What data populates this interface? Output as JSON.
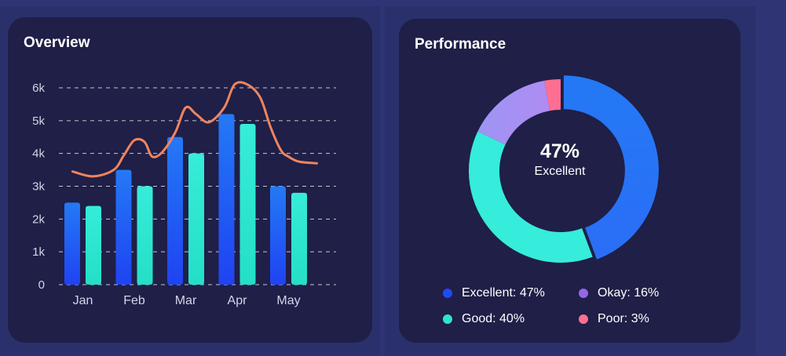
{
  "overview": {
    "title": "Overview",
    "chart_data": {
      "type": "bar",
      "categories": [
        "Jan",
        "Feb",
        "Mar",
        "Apr",
        "May"
      ],
      "series": [
        {
          "values": [
            2500,
            3500,
            4500,
            5200,
            3000
          ],
          "color": "#2160f0"
        },
        {
          "values": [
            2400,
            3000,
            4000,
            4900,
            2800
          ],
          "color": "#2ee8d2"
        }
      ],
      "line_series": {
        "color": "#f0845e",
        "x": [
          -0.2,
          0.2,
          0.6,
          0.8,
          1.0,
          1.2,
          1.35,
          1.55,
          1.8,
          2.0,
          2.2,
          2.45,
          2.75,
          2.95,
          3.2,
          3.45,
          3.65,
          3.85,
          4.0,
          4.2,
          4.55
        ],
        "values": [
          3450,
          3300,
          3500,
          3950,
          4400,
          4350,
          3900,
          4050,
          4650,
          5400,
          5200,
          4950,
          5400,
          6100,
          6100,
          5700,
          4800,
          4100,
          3900,
          3750,
          3700
        ]
      },
      "y_ticks": [
        0,
        1000,
        2000,
        3000,
        4000,
        5000,
        6000
      ],
      "y_tick_labels": [
        "0",
        "1k",
        "2k",
        "3k",
        "4k",
        "5k",
        "6k"
      ],
      "ylim": [
        0,
        6000
      ],
      "grid": true,
      "title": "Overview",
      "xlabel": "",
      "ylabel": ""
    }
  },
  "performance": {
    "title": "Performance",
    "center_value": "47%",
    "center_label": "Excellent",
    "chart_data": {
      "type": "pie",
      "title": "Performance",
      "slices": [
        {
          "label": "Excellent",
          "value": 47,
          "color": "#2479f5"
        },
        {
          "label": "Good",
          "value": 40,
          "color": "#36ecda"
        },
        {
          "label": "Okay",
          "value": 16,
          "color": "#a18cf2"
        },
        {
          "label": "Poor",
          "value": 3,
          "color": "#ff6f91"
        }
      ]
    },
    "legend": [
      {
        "text": "Excellent: 47%",
        "color": "#1f4af5"
      },
      {
        "text": "Okay: 16%",
        "color": "#9467e8"
      },
      {
        "text": "Good: 40%",
        "color": "#32e3cc"
      },
      {
        "text": "Poor: 3%",
        "color": "#ff6f91"
      }
    ]
  }
}
